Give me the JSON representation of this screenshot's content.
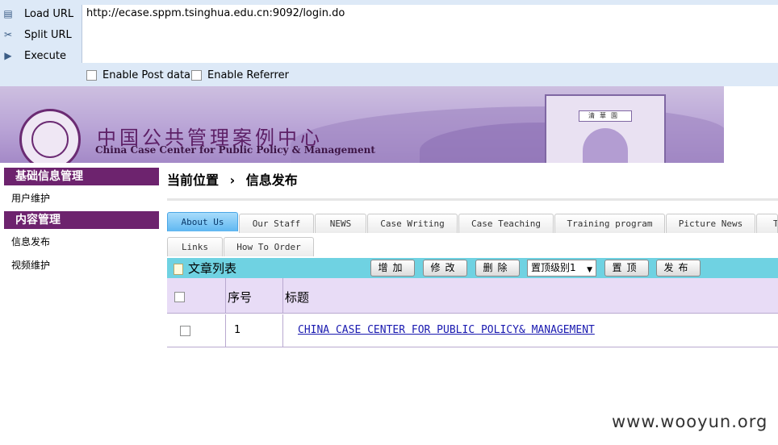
{
  "hackbar": {
    "load_url_label": "Load URL",
    "split_url_label": "Split URL",
    "execute_label": "Execute",
    "url_value": "http://ecase.sppm.tsinghua.edu.cn:9092/login.do",
    "enable_post_label": "Enable Post data",
    "enable_referrer_label": "Enable Referrer"
  },
  "banner": {
    "cn_title": "中国公共管理案例中心",
    "en_title": "China Case Center for Public Policy & Management",
    "gate_plaque": "清華園"
  },
  "sidebar": {
    "sections": [
      {
        "title": "基础信息管理",
        "items": [
          "用户维护"
        ]
      },
      {
        "title": "内容管理",
        "items": [
          "信息发布",
          "视频维护"
        ]
      }
    ]
  },
  "breadcrumb": {
    "label": "当前位置",
    "separator": "›",
    "current": "信息发布"
  },
  "tabs": {
    "row1": [
      "About Us",
      "Our Staff",
      "NEWS",
      "Case Writing",
      "Case Teaching",
      "Training program",
      "Picture News",
      "T"
    ],
    "row2": [
      "Links",
      "How To Order"
    ],
    "active": "About Us"
  },
  "list": {
    "title": "文章列表",
    "buttons": {
      "add": "增加",
      "edit": "修改",
      "delete": "删除",
      "top": "置顶",
      "publish": "发布"
    },
    "select_value": "置顶级别1",
    "headers": {
      "seq": "序号",
      "title": "标题"
    },
    "rows": [
      {
        "seq": "1",
        "title": "CHINA CASE CENTER FOR PUBLIC POLICY& MANAGEMENT"
      }
    ]
  },
  "watermark": "www.wooyun.org"
}
